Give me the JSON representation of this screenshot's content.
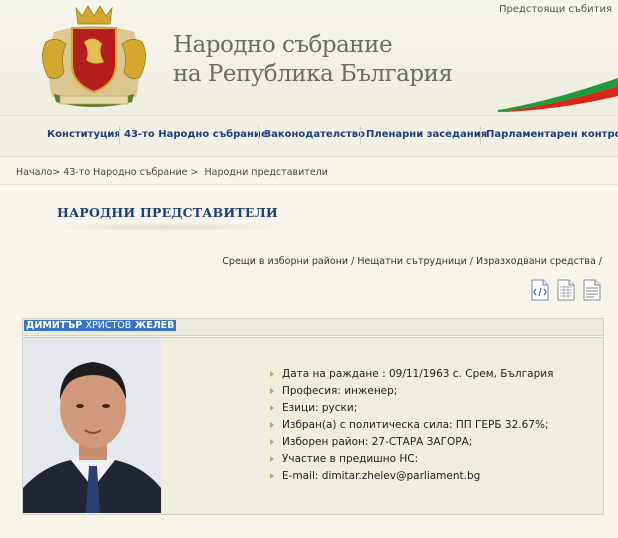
{
  "header": {
    "upcoming_events": "Предстоящи събития",
    "title_line1": "Народно събрание",
    "title_line2": "на Република България"
  },
  "nav": {
    "items": [
      {
        "label": "Конституция"
      },
      {
        "label": "43-то Народно събрание"
      },
      {
        "label": "Законодателство"
      },
      {
        "label": "Пленарни заседания"
      },
      {
        "label": "Парламентарен контрол"
      }
    ]
  },
  "breadcrumb": {
    "home": "Начало>",
    "assembly": "43-то Народно събрание",
    "sep": ">",
    "current": "Народни представители"
  },
  "section": {
    "title": "НАРОДНИ ПРЕДСТАВИТЕЛИ"
  },
  "links": {
    "meetings": "Срещи в изборни райони",
    "staff": "Нещатни сътрудници",
    "expenses": "Изразходвани средства",
    "sep": " / "
  },
  "doc_icons": [
    "xml-icon",
    "grid-doc-icon",
    "text-doc-icon"
  ],
  "profile": {
    "name_first": "ДИМИТЪР",
    "name_middle": "ХРИСТОВ",
    "name_last": "ЖЕЛЕВ",
    "details": [
      "Дата на раждане : 09/11/1963 с. Срем, България",
      "Професия: инженер;",
      "Езици: руски;",
      "Избран(а) с политическа сила: ПП ГЕРБ 32.67%;",
      "Изборен район: 27-СТАРА ЗАГОРА;",
      "Участие в предишно НС:",
      "E-mail: dimitar.zhelev@parliament.bg"
    ]
  },
  "colors": {
    "nav_text": "#1d3f75",
    "name_highlight": "#3a73c7",
    "flag_green": "#1f9a3c",
    "flag_red": "#d62718",
    "bullet": "#b7a86a"
  }
}
